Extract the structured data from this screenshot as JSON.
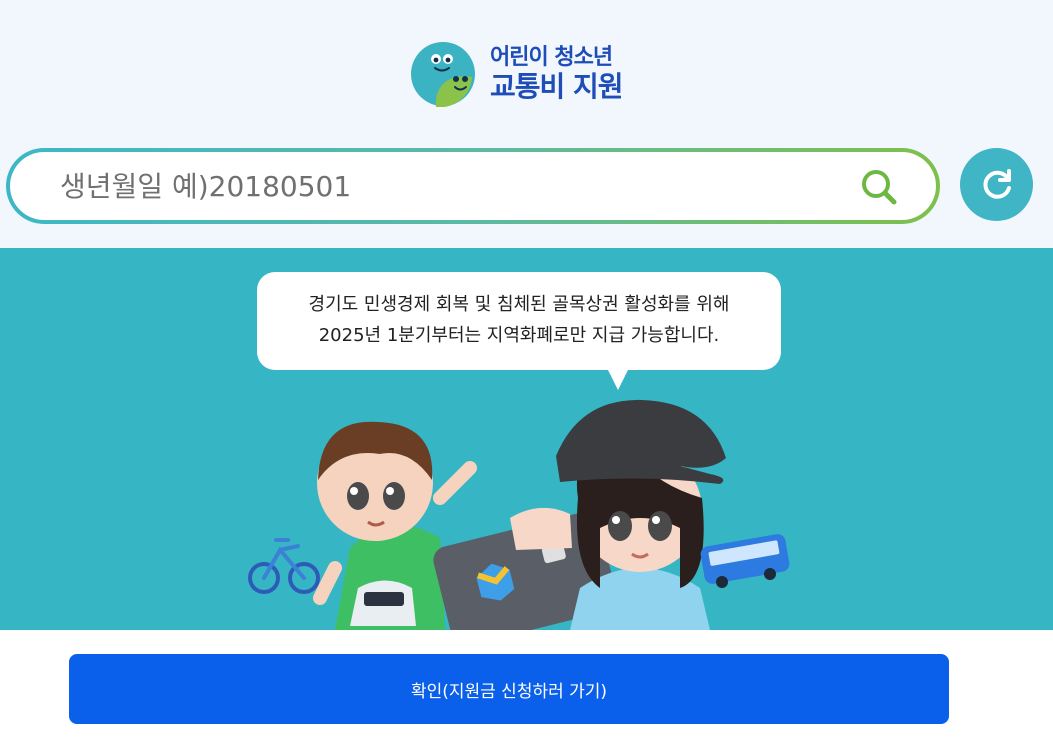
{
  "logo": {
    "line1": "어린이 청소년",
    "line2": "교통비 지원",
    "brand_color": "#1e4db8"
  },
  "search": {
    "placeholder": "생년월일 예)20180501",
    "value": "",
    "icon": "search-icon",
    "gradient_start": "#3db7c6",
    "gradient_end": "#7ec04a"
  },
  "refresh": {
    "icon": "refresh-icon",
    "color": "#3fb5c5"
  },
  "notice": {
    "line1": "경기도 민생경제 회복 및 침체된 골목상권 활성화를 위해",
    "line2": "2025년 1분기부터는 지역화폐로만 지급 가능합니다."
  },
  "hero": {
    "background": "#36b6c5"
  },
  "confirm": {
    "label": "확인(지원금 신청하러 가기)",
    "color": "#0a60ea"
  }
}
